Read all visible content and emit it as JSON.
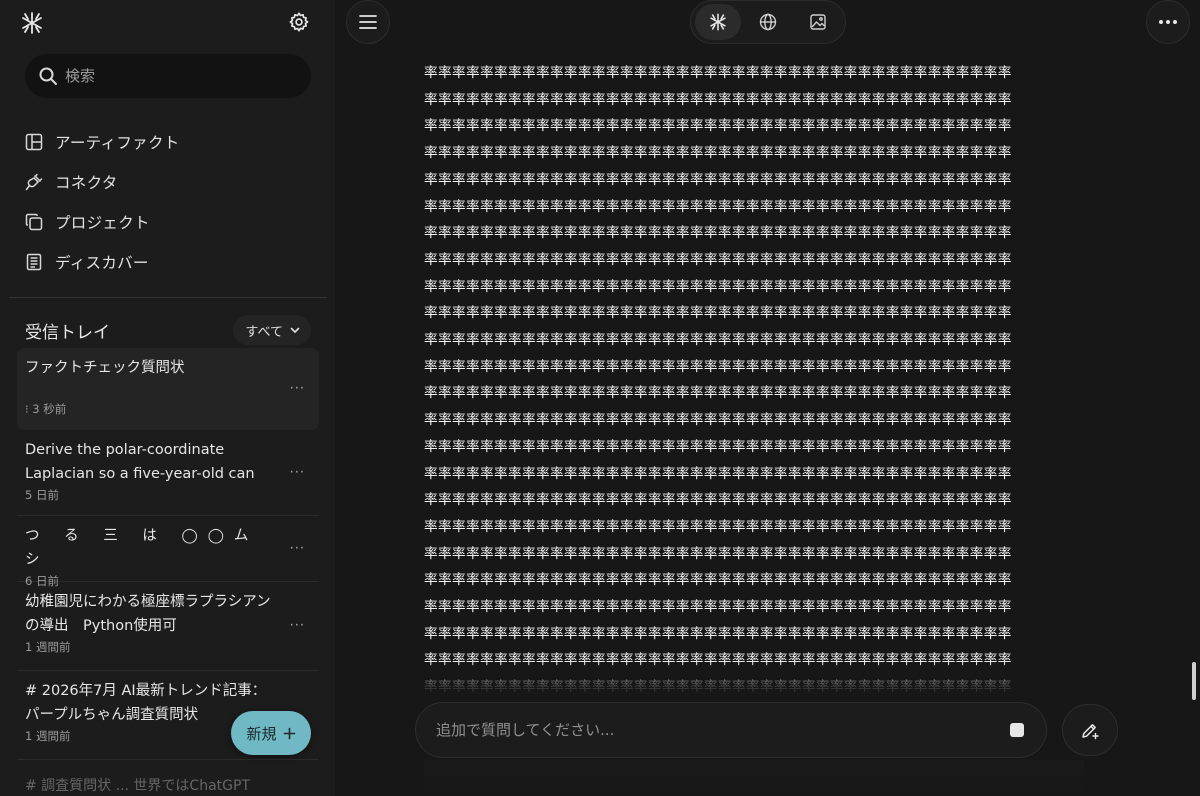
{
  "sidebar": {
    "logo_icon": "spark-logo-icon",
    "settings_icon": "gear-icon",
    "search": {
      "placeholder": "検索",
      "value": ""
    },
    "nav": [
      {
        "label": "アーティファクト",
        "icon": "artifact-icon"
      },
      {
        "label": "コネクタ",
        "icon": "plug-icon"
      },
      {
        "label": "プロジェクト",
        "icon": "folders-icon"
      },
      {
        "label": "ディスカバー",
        "icon": "newspaper-icon"
      }
    ],
    "inbox": {
      "title": "受信トレイ",
      "filter": "すべて",
      "items": [
        {
          "title": "ファクトチェック質問状",
          "time": "⁝ 3 秒前"
        },
        {
          "title": "Derive the polar-coordinate Laplacian so a five-year-old can",
          "time": "5 日前"
        },
        {
          "title": "つ る 三 は ◯◯ム シ",
          "time": "6 日前"
        },
        {
          "title": "幼稚園児にわかる極座標ラプラシアンの導出　Python使用可",
          "time": "1 週間前"
        },
        {
          "title": "# 2026年7月 AI最新トレンド記事：パープルちゃん調査質問状",
          "time": "1 週間前"
        }
      ],
      "more_label": "···",
      "peek": "# 調査質問状 ... 世界ではChatGPT"
    },
    "new_button": {
      "label": "新規",
      "icon": "plus-icon"
    }
  },
  "header": {
    "menu_icon": "hamburger-icon",
    "modes": [
      {
        "name": "spark-mode",
        "icon": "spark-logo-icon",
        "active": true
      },
      {
        "name": "web-mode",
        "icon": "globe-icon",
        "active": false
      },
      {
        "name": "image-mode",
        "icon": "image-icon",
        "active": false
      }
    ],
    "more_icon": "ellipsis-icon"
  },
  "content": {
    "glyph": "率",
    "per_line": 42,
    "lines": 24
  },
  "composer": {
    "placeholder": "追加で質問してください...",
    "value": "",
    "stop_icon": "stop-icon",
    "new_chat_icon": "pen-plus-icon"
  },
  "colors": {
    "background": "#171717",
    "sidebar": "#1c1c1c",
    "accent": "#6fb8c4",
    "text": "#e6e6e6",
    "muted": "#9a9a9a"
  }
}
